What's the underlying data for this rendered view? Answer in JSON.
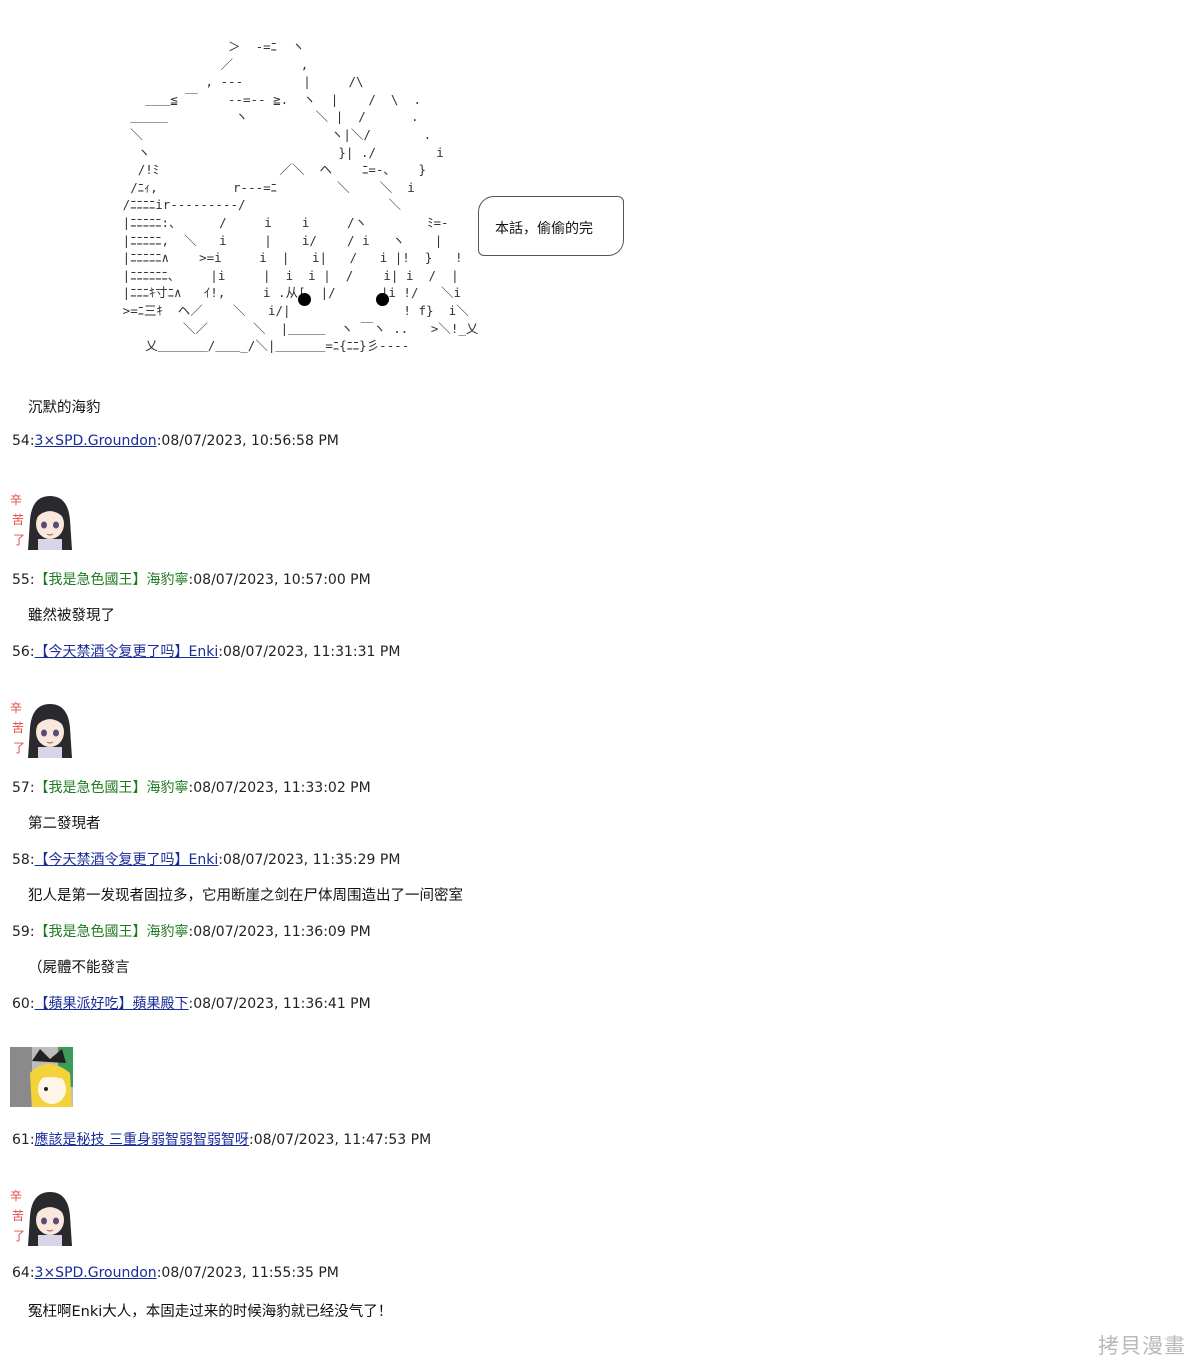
{
  "ascii_art": "                     ＞  -=ﾆ  ヽ\n                    ／         ,\n                  , ---        |     /\\\n          ＿＿≦ ￣    --=-- ≧.  ヽ  |    /  \\  .\n        ＿＿＿         ヽ         ＼ |  /      .\n        ＼                         ヽ|＼/       .\n         ヽ                         }| ./        i\n         /!ﾐ                ／＼  ヘ    ﾆ=-、   }\n        /ﾆｨ,          r---=ﾆ        ＼    ＼  i\n       /ﾆﾆﾆﾆir---------/                   ＼\n       |ﾆﾆﾆﾆﾆ:、     /     i    i     /ヽ        ﾐ=-\n       |ﾆﾆﾆﾆﾆ,  ＼   i     |    i/    / i   ヽ    |\n       |ﾆﾆﾆﾆﾆ∧    >=i     i  |   i|   /   i |!  }   !\n       |ﾆﾆﾆﾆﾆﾆ、    |i     |  i  i |  /    i| i  /  |\n       |ﾆﾆﾆｷ寸ﾆ∧   ｲ!,     i .从[  |/      |i !/   ＼i\n       >=ﾆ三ｷ  ヘ／    ＼   i/|               ! f}  i＼\n               ＼／      ＼  |＿＿＿  ヽ ￣ヽ ..   >＼!_乂\n          乂＿＿＿＿/＿＿_/＼|＿＿＿＿=ﾆ{ﾆﾆ}彡----",
  "bubble_text": "本話，偷偷的完",
  "caption": "沉默的海豹",
  "posts": [
    {
      "num": "54",
      "name_type": "link",
      "name": "3×SPD.Groundon",
      "time": "08/07/2023, 10:56:58 PM"
    },
    {
      "num": "55",
      "name_type": "green",
      "name": "【我是急色國王】海豹寧",
      "time": "08/07/2023, 10:57:00 PM",
      "body": "雖然被發現了"
    },
    {
      "num": "56",
      "name_type": "link",
      "name": "【今天禁酒令复更了吗】Enki",
      "time": "08/07/2023, 11:31:31 PM"
    },
    {
      "num": "57",
      "name_type": "green",
      "name": "【我是急色國王】海豹寧",
      "time": "08/07/2023, 11:33:02 PM",
      "body": "第二發現者"
    },
    {
      "num": "58",
      "name_type": "link",
      "name": "【今天禁酒令复更了吗】Enki",
      "time": "08/07/2023, 11:35:29 PM",
      "body": "犯人是第一发现者固拉多，它用断崖之剑在尸体周围造出了一间密室"
    },
    {
      "num": "59",
      "name_type": "green",
      "name": "【我是急色國王】海豹寧",
      "time": "08/07/2023, 11:36:09 PM",
      "body": "（屍體不能發言"
    },
    {
      "num": "60",
      "name_type": "link",
      "name": "【蘋果派好吃】蘋果殿下",
      "time": "08/07/2023, 11:36:41 PM"
    },
    {
      "num": "61",
      "name_type": "link",
      "name": "應該是秘技 三重身弱智弱智弱智呀",
      "time": "08/07/2023, 11:47:53 PM"
    },
    {
      "num": "64",
      "name_type": "link",
      "name": "3×SPD.Groundon",
      "time": "08/07/2023, 11:55:35 PM",
      "body": "冤枉啊Enki大人，本固走过来的时候海豹就已经没气了！"
    }
  ],
  "sticker_text": "辛苦了",
  "watermark": "拷貝漫畫",
  "colors": {
    "link": "#1a2b9a",
    "green": "#1f7a1f"
  }
}
